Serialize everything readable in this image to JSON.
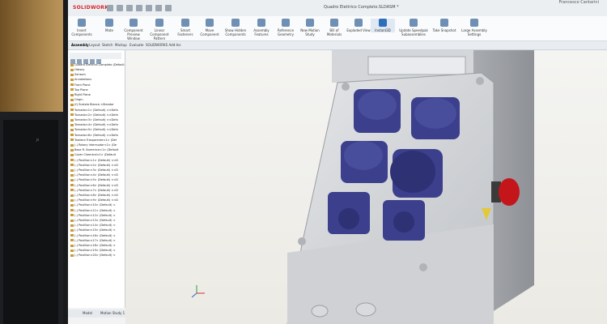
{
  "app": {
    "logo": "SOLIDWORKS",
    "document_title": "Quadro Elettrico Completo.SLDASM *",
    "user": "Francesco Cantarini"
  },
  "ribbon": [
    {
      "label": "Insert Components"
    },
    {
      "label": "Mate"
    },
    {
      "label": "Component Preview Window"
    },
    {
      "label": "Linear Component Pattern"
    },
    {
      "label": "Smart Fasteners"
    },
    {
      "label": "Move Component"
    },
    {
      "label": "Show Hidden Components"
    },
    {
      "label": "Assembly Features"
    },
    {
      "label": "Reference Geometry"
    },
    {
      "label": "New Motion Study"
    },
    {
      "label": "Bill of Materials"
    },
    {
      "label": "Exploded View"
    },
    {
      "label": "Instant3D"
    },
    {
      "label": "Update Speedpak Subassemblies"
    },
    {
      "label": "Take Snapshot"
    },
    {
      "label": "Large Assembly Settings"
    }
  ],
  "tabs": [
    "Assembly",
    "Layout",
    "Sketch",
    "Markup",
    "Evaluate",
    "SOLIDWORKS Add-Ins"
  ],
  "tree": {
    "root": "Quadro Elettrico Completo (Default",
    "items": [
      "History",
      "Sensors",
      "Annotations",
      "Front Plane",
      "Top Plane",
      "Right Plane",
      "Origin",
      "(f) Scatola Bianca <Standar",
      "Tornado<1> (Default) <<Defa",
      "Tornado<2> (Default) <<Defa",
      "Tornado<3> (Default) <<Defa",
      "Tornado<4> (Default) <<Defa",
      "Tornado<5> (Default) <<Defa",
      "Tornado<6> (Default) <<Defa",
      "Tastiera Trasparente<1> (Def",
      "(-) Rotary Interruptor<1> (De",
      "Base R. Numerica<1> (Default",
      "Cover Chemical<1> (Default",
      "(-) Pavillion<1> (Default) <<D",
      "(-) Pavillion<2> (Default) <<D",
      "(-) Pavillion<3> (Default) <<D",
      "(-) Pavillion<4> (Default) <<D",
      "(-) Pavillion<5> (Default) <<D",
      "(-) Pavillion<6> (Default) <<D",
      "(-) Pavillion<7> (Default) <<D",
      "(-) Pavillion<8> (Default) <<D",
      "(-) Pavillion<9> (Default) <<D",
      "(-) Pavillion<10> (Default) <",
      "(-) Pavillion<11> (Default) <",
      "(-) Pavillion<12> (Default) <",
      "(-) Pavillion<13> (Default) <",
      "(-) Pavillion<14> (Default) <",
      "(-) Pavillion<15> (Default) <",
      "(-) Pavillion<16> (Default) <",
      "(-) Pavillion<17> (Default) <",
      "(-) Pavillion<18> (Default) <",
      "(-) Pavillion<19> (Default) <",
      "(-) Pavillion<20> (Default) <"
    ]
  },
  "bottom_tabs": [
    "Model",
    "Motion Study 1"
  ],
  "colors": {
    "socket": "#3b3f8c",
    "enclosure": "#c9cbcf",
    "stop_button": "#c4151b"
  }
}
